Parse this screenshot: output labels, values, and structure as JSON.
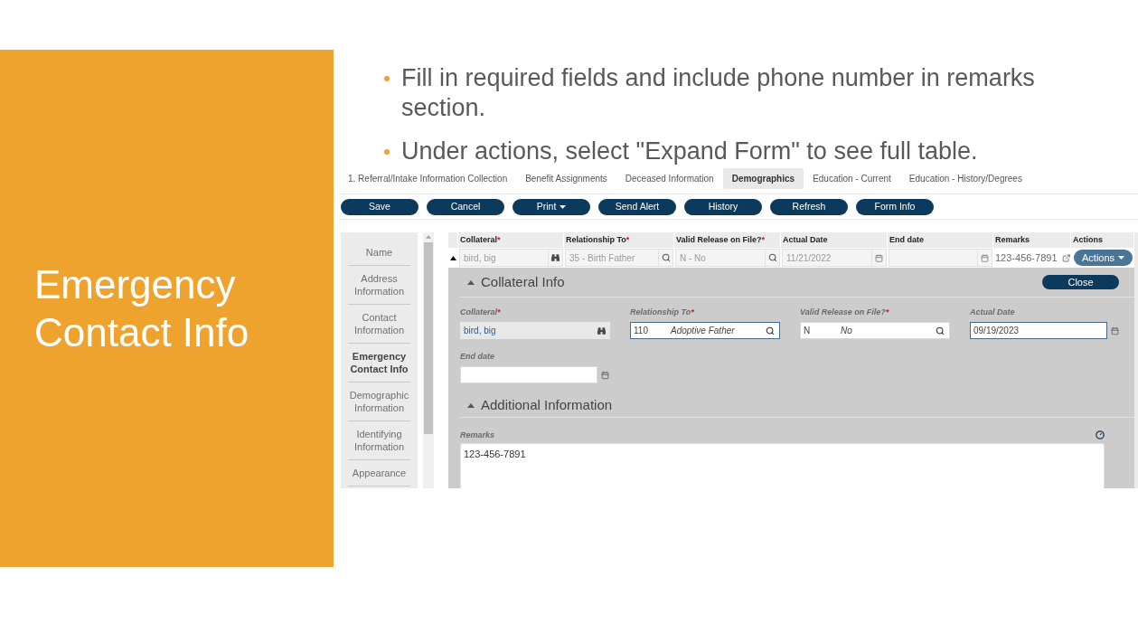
{
  "slide": {
    "title": "Emergency Contact Info",
    "bullets": [
      "Fill in required fields and include phone number in remarks section.",
      "Under actions, select \"Expand Form\" to see full table."
    ]
  },
  "tabs": [
    {
      "label": "1. Referral/Intake Information Collection",
      "selected": false
    },
    {
      "label": "Benefit Assignments",
      "selected": false
    },
    {
      "label": "Deceased Information",
      "selected": false
    },
    {
      "label": "Demographics",
      "selected": true
    },
    {
      "label": "Education - Current",
      "selected": false
    },
    {
      "label": "Education - History/Degrees",
      "selected": false
    }
  ],
  "toolbar": [
    {
      "label": "Save",
      "dropdown": false
    },
    {
      "label": "Cancel",
      "dropdown": false
    },
    {
      "label": "Print",
      "dropdown": true
    },
    {
      "label": "Send Alert",
      "dropdown": false
    },
    {
      "label": "History",
      "dropdown": false
    },
    {
      "label": "Refresh",
      "dropdown": false
    },
    {
      "label": "Form Info",
      "dropdown": false
    }
  ],
  "sidebar": {
    "items": [
      {
        "label": "Name",
        "selected": false
      },
      {
        "label": "Address Information",
        "selected": false
      },
      {
        "label": "Contact Information",
        "selected": false
      },
      {
        "label": "Emergency Contact Info",
        "selected": true
      },
      {
        "label": "Demographic Information",
        "selected": false
      },
      {
        "label": "Identifying Information",
        "selected": false
      },
      {
        "label": "Appearance",
        "selected": false
      }
    ]
  },
  "table": {
    "columns": [
      {
        "label": "Collateral",
        "required_mark": "*"
      },
      {
        "label": "Relationship To",
        "required_mark": "*"
      },
      {
        "label": "Valid Release on File?",
        "required_mark": "*"
      },
      {
        "label": "Actual Date"
      },
      {
        "label": "End date"
      },
      {
        "label": "Remarks"
      },
      {
        "label": "Actions"
      }
    ],
    "rows": [
      {
        "expanded": true,
        "disabled": true,
        "cells": [
          {
            "kind": "person",
            "value": "bird, big"
          },
          {
            "kind": "lookup",
            "value": "35 - Birth Father"
          },
          {
            "kind": "lookup",
            "value": "N - No"
          },
          {
            "kind": "date",
            "value": "11/21/2022"
          },
          {
            "kind": "date"
          },
          {
            "kind": "note",
            "value": "123-456-7891"
          },
          {
            "kind": "menu",
            "value": "Actions"
          }
        ]
      }
    ]
  },
  "detail_form": {
    "close_button": "Close",
    "sections": [
      {
        "title": "Collateral Info",
        "expanded": true,
        "fields": [
          {
            "kind": "person",
            "label": "Collateral",
            "required_mark": "*",
            "value": "bird, big",
            "readonly": true,
            "highlighted": false
          },
          {
            "kind": "lookup",
            "label": "Relationship To",
            "required_mark": "*",
            "code": "110",
            "value": "Adoptive Father",
            "readonly": false,
            "highlighted": true
          },
          {
            "kind": "lookup",
            "label": "Valid Release on File?",
            "required_mark": "*",
            "code": "N",
            "value": "No",
            "readonly": false,
            "highlighted": false
          },
          {
            "kind": "date",
            "label": "Actual Date",
            "value": "09/19/2023",
            "readonly": false,
            "highlighted": true
          },
          {
            "kind": "date",
            "label": "End date",
            "readonly": false,
            "highlighted": false
          }
        ]
      },
      {
        "title": "Additional Information",
        "expanded": true,
        "fields": [
          {
            "kind": "textarea",
            "label": "Remarks",
            "value": "123-456-7891"
          }
        ]
      }
    ]
  }
}
